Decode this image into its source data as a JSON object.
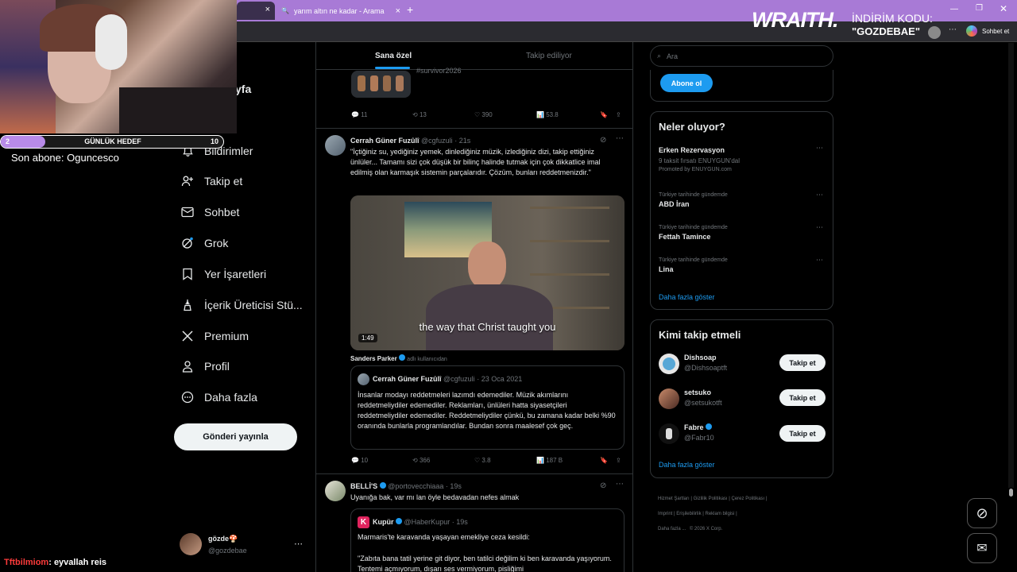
{
  "browser": {
    "tab_active_label": "",
    "tab2_label": "yarım altın ne kadar - Arama",
    "sohbet_label": "Sohbet et"
  },
  "overlay": {
    "sponsor_brand": "WRAITH.",
    "discount_label": "İNDİRİM KODU:",
    "discount_code": "\"GOZDEBAE\"",
    "goal_label": "GÜNLÜK HEDEF",
    "goal_current": "2",
    "goal_target": "10",
    "goal_progress": 0.2,
    "last_sub": "Son abone: Oguncesco",
    "chat_user": "Tftbilmiom",
    "chat_message": ": eyvallah reis"
  },
  "nav": {
    "home_partial": "yfa",
    "items": [
      {
        "label": "Bildirimler",
        "icon": "bell-icon"
      },
      {
        "label": "Takip et",
        "icon": "person-add-icon"
      },
      {
        "label": "Sohbet",
        "icon": "mail-icon"
      },
      {
        "label": "Grok",
        "icon": "grok-icon"
      },
      {
        "label": "Yer İşaretleri",
        "icon": "bookmark-icon"
      },
      {
        "label": "İçerik Üreticisi Stü...",
        "icon": "creator-icon"
      },
      {
        "label": "Premium",
        "icon": "x-logo-icon"
      },
      {
        "label": "Profil",
        "icon": "person-icon"
      },
      {
        "label": "Daha fazla",
        "icon": "more-circle-icon"
      }
    ],
    "post_button": "Gönderi yayınla",
    "account_name": "gözde🍄",
    "account_handle": "@gozdebae"
  },
  "feed": {
    "tabs": [
      "Sana özel",
      "Takip ediliyor"
    ],
    "top_tweet": {
      "hashtag": "#survivor2026",
      "replies": "11",
      "reposts": "13",
      "likes": "390",
      "views": "53.8"
    },
    "tweet1": {
      "name": "Cerrah Güner Fuzûlî",
      "handle": "@cgfuzuli",
      "time": "21s",
      "text": "\"İçtiğiniz su, yediğiniz yemek, dinlediğiniz müzik, izlediğiniz dizi, takip ettiğiniz ünlüler... Tamamı sizi çok düşük bir bilinç halinde tutmak için çok dikkatlice imal edilmiş olan karmaşık sistemin parçalarıdır. Çözüm, bunları reddetmenizdir.\"",
      "video_caption": "the way that Christ taught you",
      "video_duration": "1:49",
      "attribution_name": "Sanders Parker",
      "attribution_suffix": "adlı kullanıcıdan",
      "quote_name": "Cerrah Güner Fuzûlî",
      "quote_handle": "@cgfuzuli",
      "quote_date": "23 Oca 2021",
      "quote_text": "İnsanlar modayı reddetmeleri lazımdı edemediler. Müzik akımlarını reddetmeliydiler edemediler. Reklamları, ünlüleri hatta siyasetçileri reddetmeliydiler edemediler. Reddetmeliydiler çünkü, bu zamana kadar belki %90 oranında bunlarla programlandılar. Bundan sonra maalesef çok geç.",
      "replies": "10",
      "reposts": "366",
      "likes": "3.8",
      "views": "187 B"
    },
    "tweet2": {
      "name": "BELLİ'S",
      "handle": "@portovecchiaaa",
      "time": "19s",
      "text": "Uyanığa bak, var mı lan öyle bedavadan nefes almak",
      "quote_name": "Kupür",
      "quote_handle": "@HaberKupur",
      "quote_time": "19s",
      "quote_text1": "Marmaris'te karavanda yaşayan emekliye ceza kesildi:",
      "quote_text2": "\"Zabıta bana tatil yerine git diyor, ben tatilci değilim ki ben karavanda yaşıyorum. Tentemi açmıyorum, dışarı ses vermiyorum, pisliğimi"
    }
  },
  "sidebar": {
    "search_placeholder": "Ara",
    "subscribe_button": "Abone ol",
    "trends_title": "Neler oluyor?",
    "trends": [
      {
        "meta": "",
        "title": "Erken Rezervasyon",
        "sub": "9 taksit fırsatı ENUYGUN'dal",
        "promo": "Promoted by ENUYGUN.com"
      },
      {
        "meta": "Türkiye tarihinde gündemde",
        "title": "ABD İran"
      },
      {
        "meta": "Türkiye tarihinde gündemde",
        "title": "Fettah Tamince"
      },
      {
        "meta": "Türkiye tarihinde gündemde",
        "title": "Lina"
      }
    ],
    "trends_more": "Daha fazla göster",
    "who_title": "Kimi takip etmeli",
    "who": [
      {
        "name": "Dishsoap",
        "handle": "@Dishsoaptft",
        "button": "Takip et"
      },
      {
        "name": "setsuko",
        "handle": "@setsukotft",
        "button": "Takip et"
      },
      {
        "name": "Fabre",
        "handle": "@Fabr10",
        "button": "Takip et"
      }
    ],
    "who_more": "Daha fazla göster",
    "footer": [
      "Hizmet Şartları",
      "Gizlilik Politikası",
      "Çerez Politikası",
      "Imprint",
      "Erişilebilirlik",
      "Reklam bilgisi",
      "Daha fazla ...",
      "© 2026 X Corp."
    ]
  }
}
